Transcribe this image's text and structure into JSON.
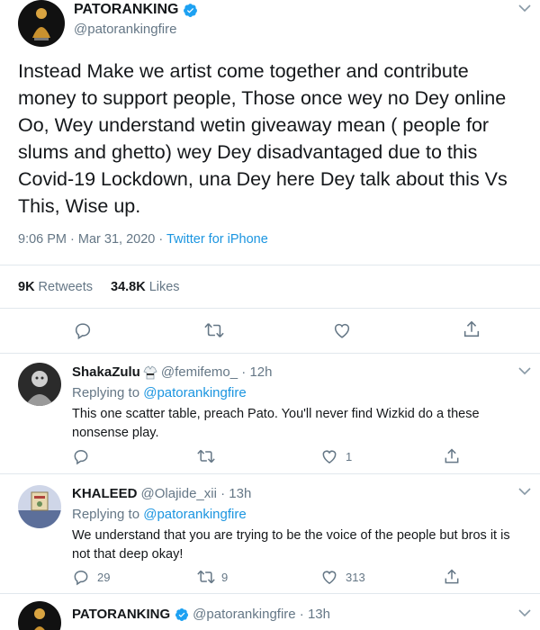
{
  "main_tweet": {
    "name": "PATORANKING",
    "handle": "@patorankingfire",
    "text": "Instead Make we artist come together and contribute money to support people, Those once wey no Dey online  Oo, Wey understand wetin giveaway mean ( people for slums and ghetto) wey Dey disadvantaged due to this Covid-19 Lockdown, una Dey here Dey talk about this Vs This, Wise up.",
    "time": "9:06 PM · Mar 31, 2020 · ",
    "source": "Twitter for iPhone",
    "retweets_count": "9K",
    "retweets_label": "Retweets",
    "likes_count": "34.8K",
    "likes_label": "Likes"
  },
  "replies": [
    {
      "name": "ShakaZulu",
      "handle": "@femifemo_ · 12h",
      "replying_label": "Replying to ",
      "replying_to": "@patorankingfire",
      "text": "This one scatter table, preach Pato. You'll never find Wizkid do a these nonsense play.",
      "reply_count": "",
      "retweet_count": "",
      "like_count": "1"
    },
    {
      "name": "KHALEED",
      "handle": "@Olajide_xii · 13h",
      "replying_label": "Replying to ",
      "replying_to": "@patorankingfire",
      "text": "We understand that you are trying to be the voice of the people but bros it is not that deep okay!",
      "reply_count": "29",
      "retweet_count": "9",
      "like_count": "313"
    },
    {
      "name": "PATORANKING",
      "handle": "@patorankingfire · 13h"
    }
  ],
  "colors": {
    "link": "#1b95e0",
    "secondary_text": "#657786",
    "border": "#e1e8ed",
    "verified": "#1da1f2"
  }
}
